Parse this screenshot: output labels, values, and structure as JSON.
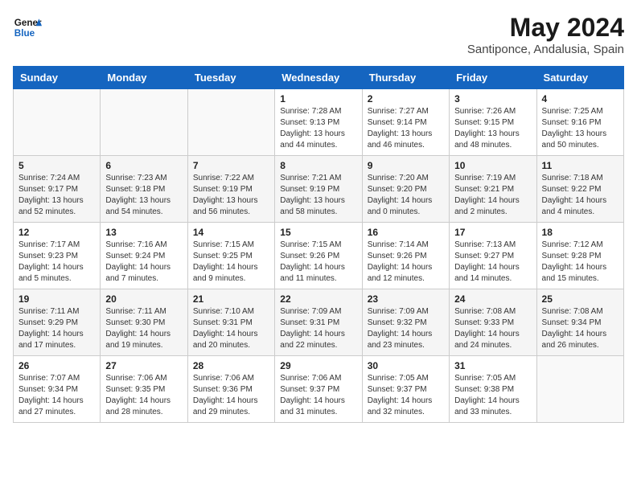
{
  "header": {
    "logo_line1": "General",
    "logo_line2": "Blue",
    "month_year": "May 2024",
    "location": "Santiponce, Andalusia, Spain"
  },
  "days_of_week": [
    "Sunday",
    "Monday",
    "Tuesday",
    "Wednesday",
    "Thursday",
    "Friday",
    "Saturday"
  ],
  "weeks": [
    [
      {
        "day": "",
        "info": ""
      },
      {
        "day": "",
        "info": ""
      },
      {
        "day": "",
        "info": ""
      },
      {
        "day": "1",
        "info": "Sunrise: 7:28 AM\nSunset: 9:13 PM\nDaylight: 13 hours and 44 minutes."
      },
      {
        "day": "2",
        "info": "Sunrise: 7:27 AM\nSunset: 9:14 PM\nDaylight: 13 hours and 46 minutes."
      },
      {
        "day": "3",
        "info": "Sunrise: 7:26 AM\nSunset: 9:15 PM\nDaylight: 13 hours and 48 minutes."
      },
      {
        "day": "4",
        "info": "Sunrise: 7:25 AM\nSunset: 9:16 PM\nDaylight: 13 hours and 50 minutes."
      }
    ],
    [
      {
        "day": "5",
        "info": "Sunrise: 7:24 AM\nSunset: 9:17 PM\nDaylight: 13 hours and 52 minutes."
      },
      {
        "day": "6",
        "info": "Sunrise: 7:23 AM\nSunset: 9:18 PM\nDaylight: 13 hours and 54 minutes."
      },
      {
        "day": "7",
        "info": "Sunrise: 7:22 AM\nSunset: 9:19 PM\nDaylight: 13 hours and 56 minutes."
      },
      {
        "day": "8",
        "info": "Sunrise: 7:21 AM\nSunset: 9:19 PM\nDaylight: 13 hours and 58 minutes."
      },
      {
        "day": "9",
        "info": "Sunrise: 7:20 AM\nSunset: 9:20 PM\nDaylight: 14 hours and 0 minutes."
      },
      {
        "day": "10",
        "info": "Sunrise: 7:19 AM\nSunset: 9:21 PM\nDaylight: 14 hours and 2 minutes."
      },
      {
        "day": "11",
        "info": "Sunrise: 7:18 AM\nSunset: 9:22 PM\nDaylight: 14 hours and 4 minutes."
      }
    ],
    [
      {
        "day": "12",
        "info": "Sunrise: 7:17 AM\nSunset: 9:23 PM\nDaylight: 14 hours and 5 minutes."
      },
      {
        "day": "13",
        "info": "Sunrise: 7:16 AM\nSunset: 9:24 PM\nDaylight: 14 hours and 7 minutes."
      },
      {
        "day": "14",
        "info": "Sunrise: 7:15 AM\nSunset: 9:25 PM\nDaylight: 14 hours and 9 minutes."
      },
      {
        "day": "15",
        "info": "Sunrise: 7:15 AM\nSunset: 9:26 PM\nDaylight: 14 hours and 11 minutes."
      },
      {
        "day": "16",
        "info": "Sunrise: 7:14 AM\nSunset: 9:26 PM\nDaylight: 14 hours and 12 minutes."
      },
      {
        "day": "17",
        "info": "Sunrise: 7:13 AM\nSunset: 9:27 PM\nDaylight: 14 hours and 14 minutes."
      },
      {
        "day": "18",
        "info": "Sunrise: 7:12 AM\nSunset: 9:28 PM\nDaylight: 14 hours and 15 minutes."
      }
    ],
    [
      {
        "day": "19",
        "info": "Sunrise: 7:11 AM\nSunset: 9:29 PM\nDaylight: 14 hours and 17 minutes."
      },
      {
        "day": "20",
        "info": "Sunrise: 7:11 AM\nSunset: 9:30 PM\nDaylight: 14 hours and 19 minutes."
      },
      {
        "day": "21",
        "info": "Sunrise: 7:10 AM\nSunset: 9:31 PM\nDaylight: 14 hours and 20 minutes."
      },
      {
        "day": "22",
        "info": "Sunrise: 7:09 AM\nSunset: 9:31 PM\nDaylight: 14 hours and 22 minutes."
      },
      {
        "day": "23",
        "info": "Sunrise: 7:09 AM\nSunset: 9:32 PM\nDaylight: 14 hours and 23 minutes."
      },
      {
        "day": "24",
        "info": "Sunrise: 7:08 AM\nSunset: 9:33 PM\nDaylight: 14 hours and 24 minutes."
      },
      {
        "day": "25",
        "info": "Sunrise: 7:08 AM\nSunset: 9:34 PM\nDaylight: 14 hours and 26 minutes."
      }
    ],
    [
      {
        "day": "26",
        "info": "Sunrise: 7:07 AM\nSunset: 9:34 PM\nDaylight: 14 hours and 27 minutes."
      },
      {
        "day": "27",
        "info": "Sunrise: 7:06 AM\nSunset: 9:35 PM\nDaylight: 14 hours and 28 minutes."
      },
      {
        "day": "28",
        "info": "Sunrise: 7:06 AM\nSunset: 9:36 PM\nDaylight: 14 hours and 29 minutes."
      },
      {
        "day": "29",
        "info": "Sunrise: 7:06 AM\nSunset: 9:37 PM\nDaylight: 14 hours and 31 minutes."
      },
      {
        "day": "30",
        "info": "Sunrise: 7:05 AM\nSunset: 9:37 PM\nDaylight: 14 hours and 32 minutes."
      },
      {
        "day": "31",
        "info": "Sunrise: 7:05 AM\nSunset: 9:38 PM\nDaylight: 14 hours and 33 minutes."
      },
      {
        "day": "",
        "info": ""
      }
    ]
  ]
}
